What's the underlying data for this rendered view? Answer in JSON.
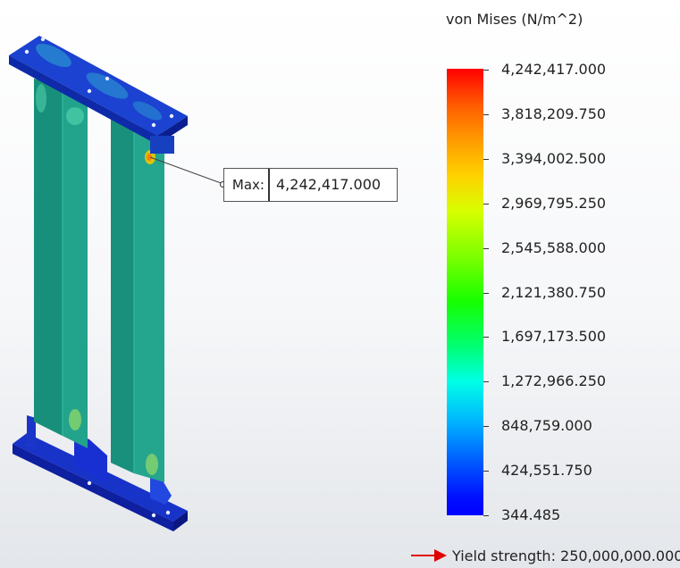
{
  "legend": {
    "title": "von Mises (N/m^2)",
    "ticks": [
      "4,242,417.000",
      "3,818,209.750",
      "3,394,002.500",
      "2,969,795.250",
      "2,545,588.000",
      "2,121,380.750",
      "1,697,173.500",
      "1,272,966.250",
      "848,759.000",
      "424,551.750",
      "344.485"
    ]
  },
  "max_probe": {
    "label": "Max:",
    "value": "4,242,417.000"
  },
  "yield": {
    "text": "Yield strength: 250,000,000.000",
    "arrow_color": "#e00000"
  },
  "colors": {
    "model_body": "#1f9e89",
    "model_base": "#1733c8",
    "hotspot": "#f0c800"
  }
}
